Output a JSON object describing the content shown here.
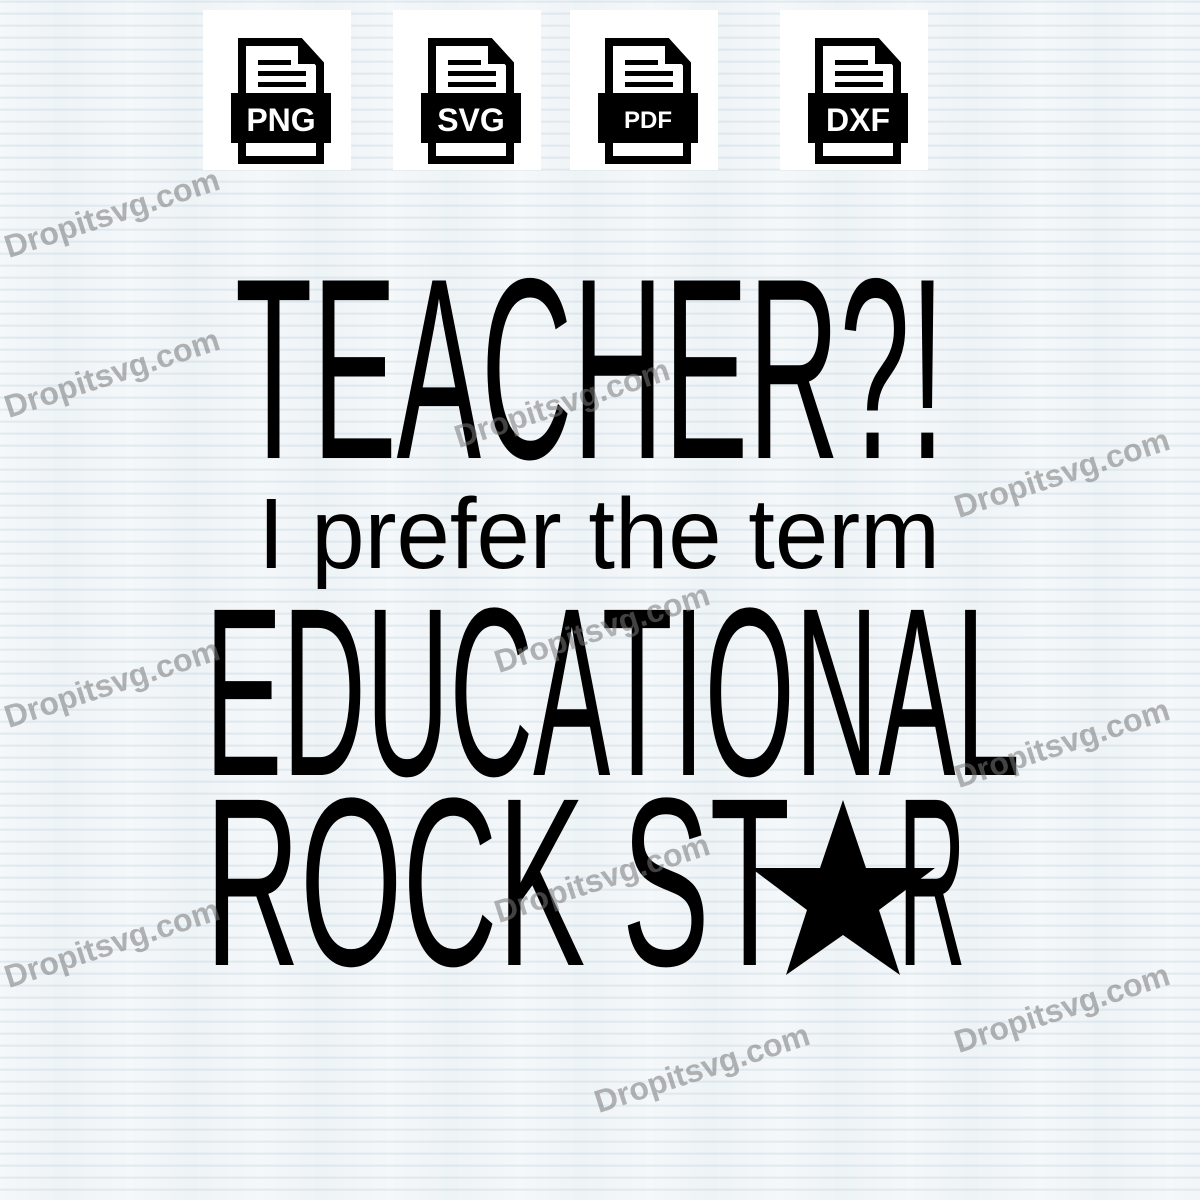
{
  "formats": [
    "PNG",
    "SVG",
    "PDF",
    "DXF"
  ],
  "design": {
    "line1": "TEACHER?!",
    "line2": "I prefer the term",
    "line3": "EDUCATIONAL",
    "line4a": "ROCK ST",
    "line4b": "R"
  },
  "watermark": "Dropitsvg.com"
}
